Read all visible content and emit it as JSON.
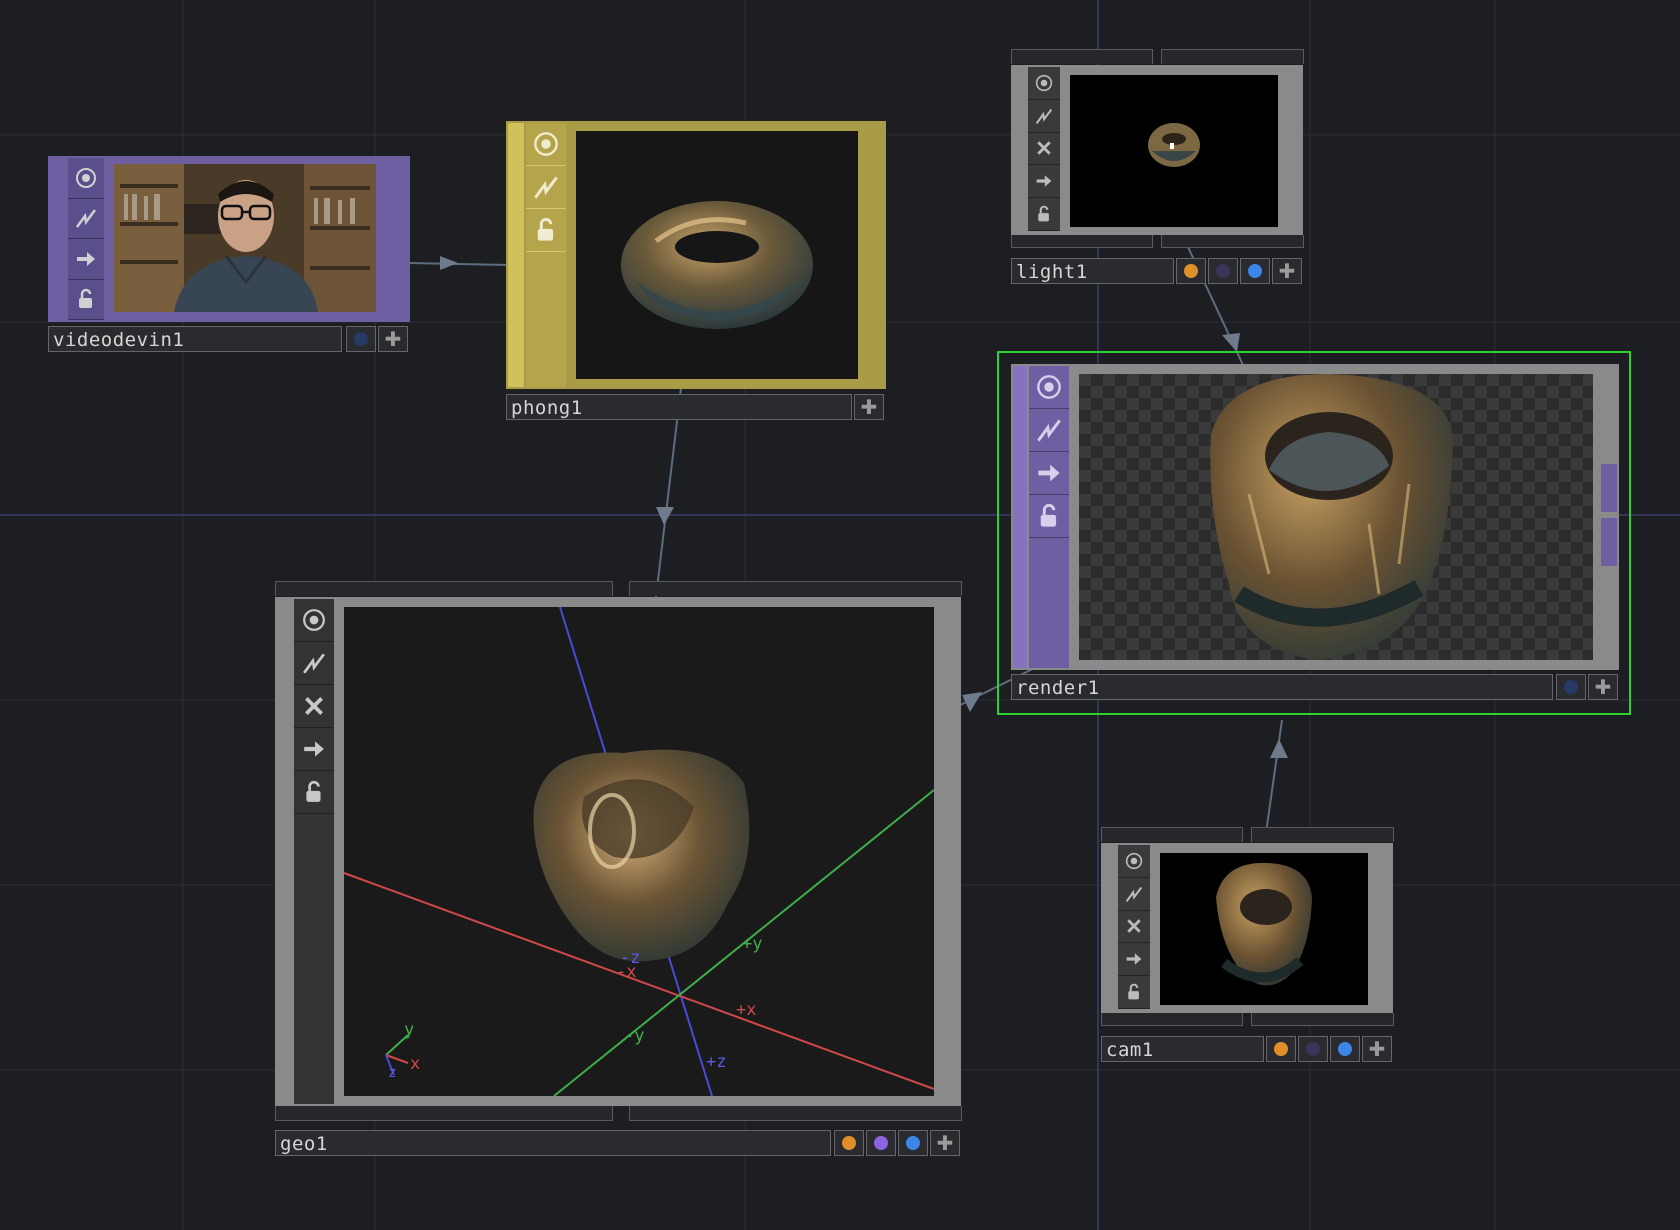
{
  "nodes": {
    "videodevin1": {
      "name": "videodevin1"
    },
    "phong1": {
      "name": "phong1"
    },
    "light1": {
      "name": "light1"
    },
    "render1": {
      "name": "render1"
    },
    "geo1": {
      "name": "geo1"
    },
    "cam1": {
      "name": "cam1"
    }
  },
  "geo_viewer": {
    "axis_labels": {
      "neg_x": "-x",
      "pos_x": "+x",
      "pos_y": "+y",
      "neg_y": "-y",
      "pos_z": "+z",
      "neg_z": "-z"
    },
    "gizmo": {
      "x": "x",
      "y": "y",
      "z": "z"
    }
  },
  "icons": [
    "viewer-toggle-icon",
    "cook-icon",
    "bypass-icon",
    "export-icon",
    "lock-icon",
    "plus-icon"
  ],
  "colors": {
    "background": "#1d1e22",
    "top_node": "#6e5fa3",
    "mat_node": "#b5a64a",
    "comp_node": "#8a8a8a",
    "selected": "#2dd12d",
    "flag_orange": "#e0902a",
    "flag_purple": "#8c63e0",
    "flag_blue": "#3d85e8",
    "axis_x": "#d04848",
    "axis_y": "#3fae4a",
    "axis_z": "#4a4ad8"
  }
}
